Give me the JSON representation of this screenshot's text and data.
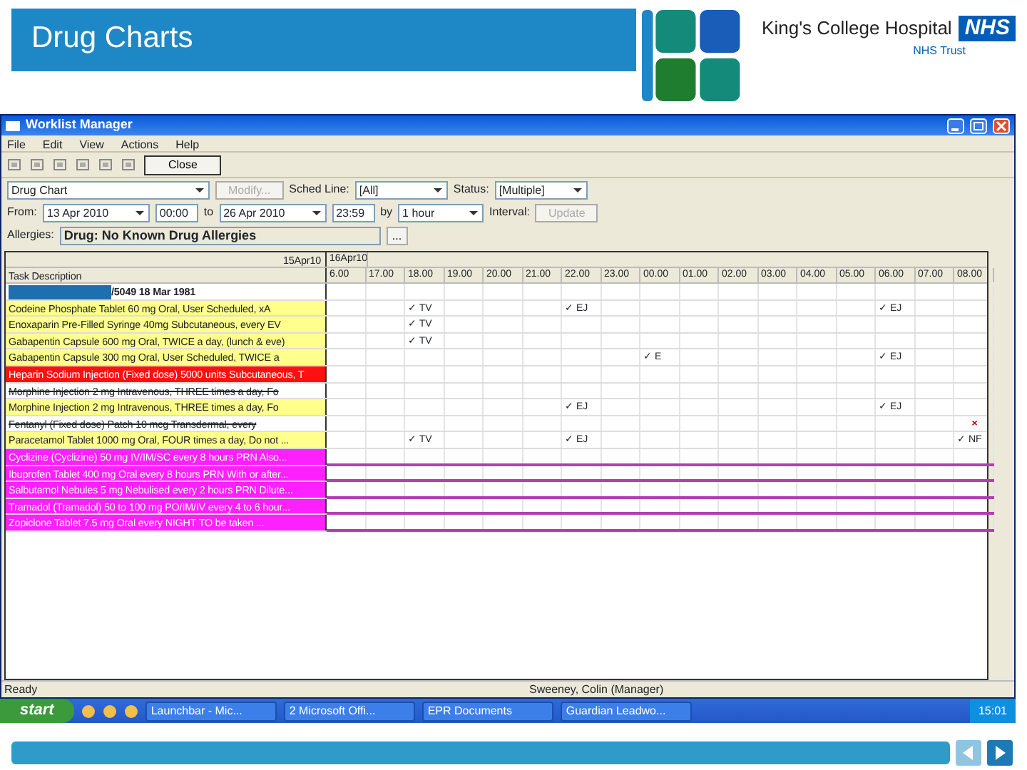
{
  "slide": {
    "title": "Drug Charts",
    "org_name": "King's College Hospital",
    "org_badge": "NHS",
    "org_subtitle": "NHS Trust"
  },
  "window": {
    "title": "Worklist Manager"
  },
  "menu": [
    "File",
    "Edit",
    "View",
    "Actions",
    "Help"
  ],
  "toolbar": {
    "close_button": "Close"
  },
  "filters": {
    "chart": "Drug Chart",
    "modify_button": "Modify...",
    "schedule_label": "Sched Line:",
    "schedule": "[All]",
    "status_label": "Status:",
    "status": "[Multiple]",
    "from_label": "From:",
    "from_date": "13 Apr 2010",
    "from_time": "00:00",
    "to_label": "to",
    "to_date": "26 Apr 2010",
    "to_time": "23:59",
    "by_label": "by",
    "interval": "1 hour",
    "interval_label": "Interval:",
    "update_button": "Update",
    "allergies_label": "Allergies:",
    "allergies": "Drug: No Known Drug Allergies",
    "allergies_button": "..."
  },
  "grid": {
    "description_header": "Task Description",
    "dates": [
      "15Apr10",
      "16Apr10"
    ],
    "hours": [
      "6.00",
      "17.00",
      "18.00",
      "19.00",
      "20.00",
      "21.00",
      "22.00",
      "23.00",
      "00.00",
      "01.00",
      "02.00",
      "03.00",
      "04.00",
      "05.00",
      "06.00",
      "07.00",
      "08.00"
    ],
    "rows": [
      {
        "kind": "patient",
        "text": "/5049 18 Mar 1981"
      },
      {
        "kind": "due",
        "text": "Codeine Phosphate Tablet 60 mg Oral, User Scheduled, xA",
        "slots": [
          {
            "kind": "empty"
          },
          {
            "kind": "empty"
          },
          {
            "kind": "given",
            "tick": "✓",
            "initials": "TV"
          },
          {
            "kind": "empty"
          },
          {
            "kind": "empty"
          },
          {
            "kind": "empty"
          },
          {
            "kind": "given",
            "tick": "✓",
            "initials": "EJ"
          },
          {
            "kind": "empty"
          },
          {
            "kind": "empty"
          },
          {
            "kind": "empty"
          },
          {
            "kind": "empty"
          },
          {
            "kind": "empty"
          },
          {
            "kind": "empty"
          },
          {
            "kind": "empty"
          },
          {
            "kind": "given",
            "tick": "✓",
            "initials": "EJ"
          },
          {
            "kind": "empty"
          },
          {
            "kind": "empty"
          }
        ]
      },
      {
        "kind": "due",
        "text": "Enoxaparin Pre-Filled Syringe 40mg Subcutaneous, every EV",
        "slots": [
          {
            "kind": "empty"
          },
          {
            "kind": "empty"
          },
          {
            "kind": "given",
            "tick": "✓",
            "initials": "TV"
          },
          {
            "kind": "empty"
          },
          {
            "kind": "empty"
          },
          {
            "kind": "empty"
          },
          {
            "kind": "empty"
          },
          {
            "kind": "empty"
          },
          {
            "kind": "empty"
          },
          {
            "kind": "empty"
          },
          {
            "kind": "empty"
          },
          {
            "kind": "empty"
          },
          {
            "kind": "empty"
          },
          {
            "kind": "empty"
          },
          {
            "kind": "empty"
          },
          {
            "kind": "empty"
          },
          {
            "kind": "empty"
          }
        ]
      },
      {
        "kind": "due",
        "text": "Gabapentin Capsule 600 mg Oral, TWICE a day, (lunch & eve)",
        "slots": [
          {
            "kind": "empty"
          },
          {
            "kind": "empty"
          },
          {
            "kind": "given",
            "tick": "✓",
            "initials": "TV"
          },
          {
            "kind": "empty"
          },
          {
            "kind": "empty"
          },
          {
            "kind": "empty"
          },
          {
            "kind": "empty"
          },
          {
            "kind": "empty"
          },
          {
            "kind": "empty"
          },
          {
            "kind": "empty"
          },
          {
            "kind": "empty"
          },
          {
            "kind": "empty"
          },
          {
            "kind": "empty"
          },
          {
            "kind": "empty"
          },
          {
            "kind": "empty"
          },
          {
            "kind": "empty"
          },
          {
            "kind": "empty"
          }
        ]
      },
      {
        "kind": "due",
        "text": "Gabapentin Capsule 300 mg Oral, User Scheduled, TWICE a",
        "slots": [
          {
            "kind": "empty"
          },
          {
            "kind": "empty"
          },
          {
            "kind": "empty"
          },
          {
            "kind": "empty"
          },
          {
            "kind": "empty"
          },
          {
            "kind": "empty"
          },
          {
            "kind": "empty"
          },
          {
            "kind": "empty"
          },
          {
            "kind": "given",
            "tick": "✓",
            "initials": "E"
          },
          {
            "kind": "empty"
          },
          {
            "kind": "empty"
          },
          {
            "kind": "empty"
          },
          {
            "kind": "empty"
          },
          {
            "kind": "empty"
          },
          {
            "kind": "given",
            "tick": "✓",
            "initials": "EJ"
          },
          {
            "kind": "empty"
          },
          {
            "kind": "empty"
          }
        ]
      },
      {
        "kind": "overdue",
        "text": "Heparin Sodium Injection (Fixed dose) 5000 units Subcutaneous, T"
      },
      {
        "kind": "discontinued",
        "text": "Morphine Injection 2 mg Intravenous, THREE times a day, Fo"
      },
      {
        "kind": "due",
        "text": "Morphine Injection 2 mg Intravenous, THREE times a day, Fo",
        "slots": [
          {
            "kind": "empty"
          },
          {
            "kind": "empty"
          },
          {
            "kind": "empty"
          },
          {
            "kind": "empty"
          },
          {
            "kind": "empty"
          },
          {
            "kind": "empty"
          },
          {
            "kind": "given",
            "tick": "✓",
            "initials": "EJ"
          },
          {
            "kind": "empty"
          },
          {
            "kind": "empty"
          },
          {
            "kind": "empty"
          },
          {
            "kind": "empty"
          },
          {
            "kind": "empty"
          },
          {
            "kind": "empty"
          },
          {
            "kind": "empty"
          },
          {
            "kind": "given",
            "tick": "✓",
            "initials": "EJ"
          },
          {
            "kind": "empty"
          },
          {
            "kind": "empty"
          }
        ]
      },
      {
        "kind": "discontinued",
        "text": "Fentanyl (Fixed dose) Patch 10 mcg Transdermal, every",
        "slots": [
          {
            "kind": "empty"
          },
          {
            "kind": "empty"
          },
          {
            "kind": "empty"
          },
          {
            "kind": "empty"
          },
          {
            "kind": "empty"
          },
          {
            "kind": "empty"
          },
          {
            "kind": "empty"
          },
          {
            "kind": "empty"
          },
          {
            "kind": "empty"
          },
          {
            "kind": "empty"
          },
          {
            "kind": "empty"
          },
          {
            "kind": "empty"
          },
          {
            "kind": "empty"
          },
          {
            "kind": "empty"
          },
          {
            "kind": "empty"
          },
          {
            "kind": "empty"
          },
          {
            "kind": "missed",
            "symbol": "×"
          }
        ]
      },
      {
        "kind": "due",
        "text": "Paracetamol Tablet 1000 mg Oral, FOUR times a day, Do not ...",
        "slots": [
          {
            "kind": "empty"
          },
          {
            "kind": "empty"
          },
          {
            "kind": "given",
            "tick": "✓",
            "initials": "TV"
          },
          {
            "kind": "empty"
          },
          {
            "kind": "empty"
          },
          {
            "kind": "empty"
          },
          {
            "kind": "given",
            "tick": "✓",
            "initials": "EJ"
          },
          {
            "kind": "empty"
          },
          {
            "kind": "empty"
          },
          {
            "kind": "empty"
          },
          {
            "kind": "empty"
          },
          {
            "kind": "empty"
          },
          {
            "kind": "empty"
          },
          {
            "kind": "empty"
          },
          {
            "kind": "empty"
          },
          {
            "kind": "empty"
          },
          {
            "kind": "given",
            "tick": "✓",
            "initials": "NF"
          }
        ]
      },
      {
        "kind": "prn",
        "text": "Cyclizine (Cyclizine) 50 mg IV/IM/SC every 8 hours PRN Also..."
      },
      {
        "kind": "prn",
        "text": "Ibuprofen Tablet 400 mg Oral every 8 hours PRN With or after..."
      },
      {
        "kind": "prn",
        "text": "Salbutamol Nebules 5 mg Nebulised every 2 hours PRN Dilute..."
      },
      {
        "kind": "prn",
        "text": "Tramadol (Tramadol) 50 to 100 mg PO/IM/IV every 4 to 6 hour..."
      },
      {
        "kind": "prn",
        "text": "Zopiclone Tablet 7.5 mg Oral every NIGHT TO be taken ..."
      }
    ]
  },
  "status_bar": [
    "Ready",
    "Sweeney, Colin (Manager)"
  ],
  "taskbar": {
    "start": "start",
    "tasks": [
      "Launchbar - Mic...",
      "2 Microsoft Offi...",
      "EPR Documents",
      "Guardian Leadwo..."
    ],
    "clock": "15:01"
  }
}
